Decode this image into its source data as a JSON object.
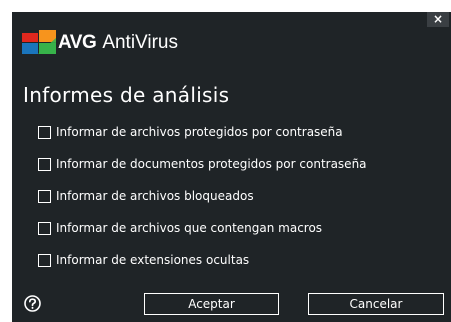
{
  "window": {
    "brand": "AVG",
    "product": "AntiVirus",
    "close_label": "×"
  },
  "dialog": {
    "title": "Informes de análisis",
    "options": [
      {
        "label": "Informar de archivos protegidos por contraseña",
        "checked": false
      },
      {
        "label": "Informar de documentos protegidos por contraseña",
        "checked": false
      },
      {
        "label": "Informar de archivos bloqueados",
        "checked": false
      },
      {
        "label": "Informar de archivos que contengan macros",
        "checked": false
      },
      {
        "label": "Informar de extensiones ocultas",
        "checked": false
      }
    ],
    "accept_label": "Aceptar",
    "cancel_label": "Cancelar",
    "help_icon": "question-circle-icon"
  },
  "colors": {
    "background": "#1f2427",
    "text": "#ffffff",
    "logo_red": "#e0281e",
    "logo_orange": "#f7941d",
    "logo_blue": "#1a75bc",
    "logo_green": "#37b24a"
  }
}
